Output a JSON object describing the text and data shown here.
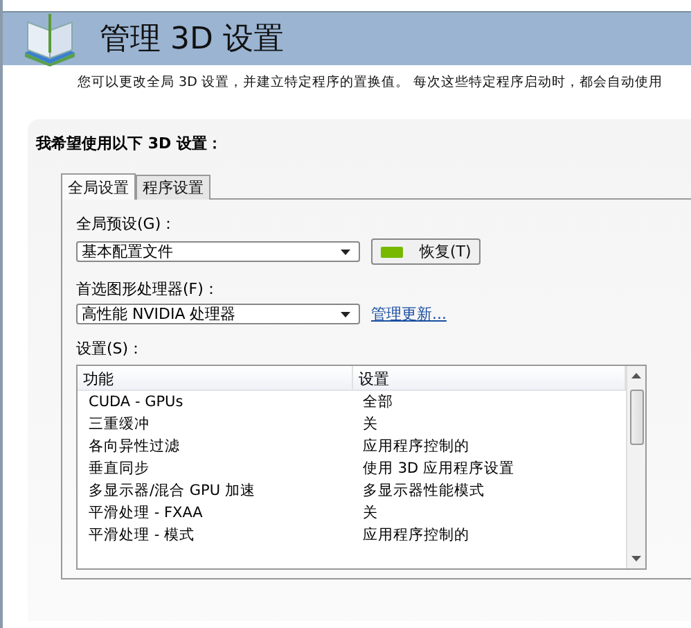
{
  "header": {
    "title": "管理 3D 设置"
  },
  "description": "您可以更改全局 3D 设置，并建立特定程序的置换值。 每次这些特定程序启动时，都会自动使用",
  "panel": {
    "heading": "我希望使用以下 3D 设置：",
    "tabs": [
      {
        "label": "全局设置",
        "selected": true
      },
      {
        "label": "程序设置",
        "selected": false
      }
    ],
    "preset": {
      "label": "全局预设(G)：",
      "value": "基本配置文件",
      "restore_button": "恢复(T)"
    },
    "processor": {
      "label": "首选图形处理器(F)：",
      "value": "高性能 NVIDIA 处理器",
      "link": "管理更新..."
    },
    "settings": {
      "label": "设置(S)：",
      "columns": [
        "功能",
        "设置"
      ],
      "rows": [
        {
          "feature": "CUDA - GPUs",
          "setting": "全部"
        },
        {
          "feature": "三重缓冲",
          "setting": "关"
        },
        {
          "feature": "各向异性过滤",
          "setting": "应用程序控制的"
        },
        {
          "feature": "垂直同步",
          "setting": "使用 3D 应用程序设置"
        },
        {
          "feature": "多显示器/混合 GPU 加速",
          "setting": "多显示器性能模式"
        },
        {
          "feature": "平滑处理 - FXAA",
          "setting": "关"
        },
        {
          "feature": "平滑处理 - 模式",
          "setting": "应用程序控制的"
        }
      ]
    }
  }
}
